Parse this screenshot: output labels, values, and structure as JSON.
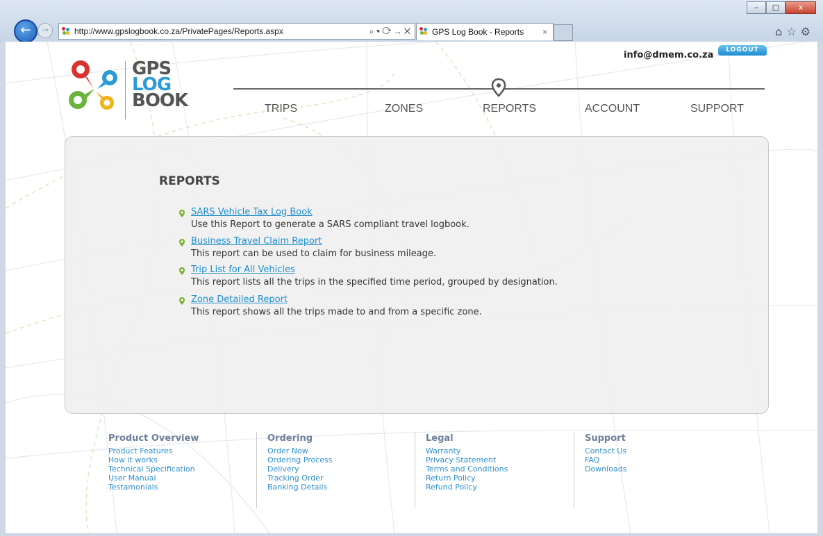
{
  "browser": {
    "url": "http://www.gpslogbook.co.za/PrivatePages/Reports.aspx",
    "address_controls": "⌕ ▾ ⟳ → ✕",
    "tab_title": "GPS Log Book - Reports",
    "tab_close": "×",
    "window_min": "–",
    "window_max": "□",
    "window_close": "x",
    "back": "←",
    "forward": "→",
    "tool_icons": "⌂☆⚙"
  },
  "header": {
    "logo_line1": "GPS",
    "logo_line2": "LOG",
    "logo_line3": "BOOK",
    "user_email": "info@dmem.co.za",
    "logout_label": "LOGOUT"
  },
  "nav": {
    "items": [
      {
        "label": "TRIPS"
      },
      {
        "label": "ZONES"
      },
      {
        "label": "REPORTS"
      },
      {
        "label": "ACCOUNT"
      },
      {
        "label": "SUPPORT"
      }
    ],
    "active": "REPORTS"
  },
  "reports": {
    "title": "REPORTS",
    "items": [
      {
        "link": "SARS Vehicle Tax Log Book",
        "desc": "Use this Report to generate a SARS compliant travel logbook."
      },
      {
        "link": "Business Travel Claim Report",
        "desc": "This report can be used to claim for business mileage."
      },
      {
        "link": "Trip List for All Vehicles",
        "desc": "This report lists all the trips in the specified time period, grouped by designation."
      },
      {
        "link": "Zone Detailed Report",
        "desc": "This report shows all the trips made to and from a specific zone."
      }
    ]
  },
  "footer": {
    "columns": [
      {
        "heading": "Product Overview",
        "links": [
          "Product Features",
          "How it works",
          "Technical Specification",
          "User Manual",
          "Testamonials"
        ]
      },
      {
        "heading": "Ordering",
        "links": [
          "Order Now",
          "Ordering Process",
          "Delivery",
          "Tracking Order",
          "Banking Details"
        ]
      },
      {
        "heading": "Legal",
        "links": [
          "Warranty",
          "Privacy Statement",
          "Terms and Conditions",
          "Return Policy",
          "Refund Policy"
        ]
      },
      {
        "heading": "Support",
        "links": [
          "Contact Us",
          "FAQ",
          "Downloads"
        ]
      }
    ]
  },
  "colors": {
    "accent_blue": "#1f8fd0",
    "logo_red": "#d8322e",
    "logo_blue": "#2a9bd6",
    "logo_green": "#6ab43e",
    "logo_yellow": "#f2b31b",
    "pin_green": "#7ab030"
  }
}
